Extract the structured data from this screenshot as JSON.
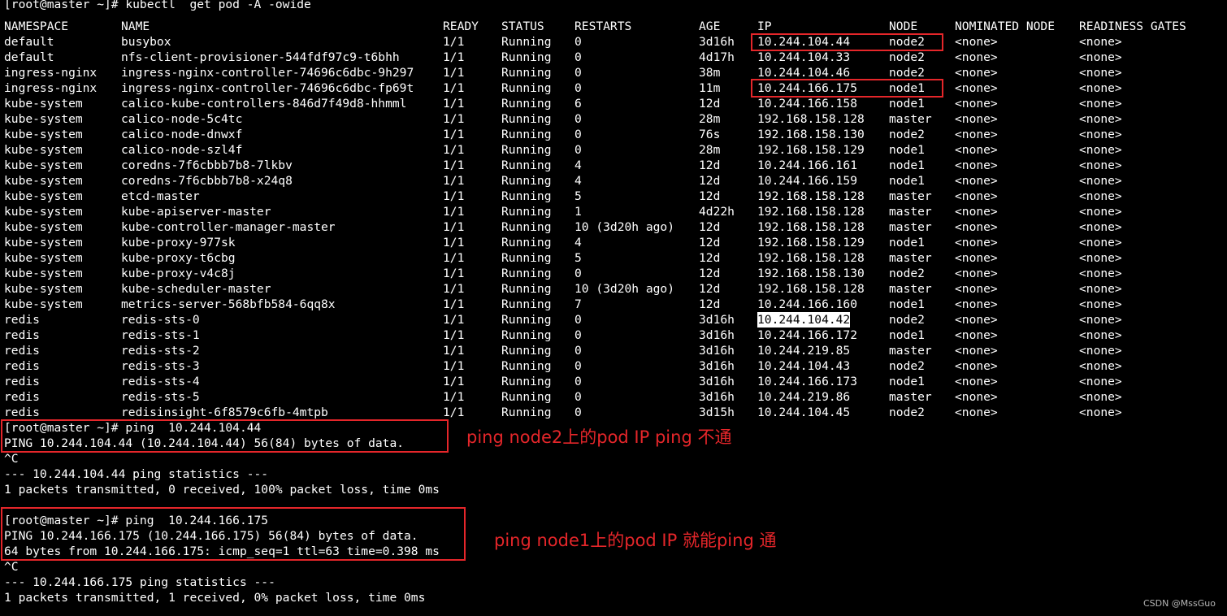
{
  "terminal": {
    "cutoff_line": "[root@master ~]# kubectl  get pod -A -owide",
    "table": {
      "headers": [
        "NAMESPACE",
        "NAME",
        "READY",
        "STATUS",
        "RESTARTS",
        "AGE",
        "IP",
        "NODE",
        "NOMINATED NODE",
        "READINESS GATES"
      ],
      "rows": [
        [
          "default",
          "busybox",
          "1/1",
          "Running",
          "0",
          "3d16h",
          "10.244.104.44",
          "node2",
          "<none>",
          "<none>"
        ],
        [
          "default",
          "nfs-client-provisioner-544fdf97c9-t6bhh",
          "1/1",
          "Running",
          "0",
          "4d17h",
          "10.244.104.33",
          "node2",
          "<none>",
          "<none>"
        ],
        [
          "ingress-nginx",
          "ingress-nginx-controller-74696c6dbc-9h297",
          "1/1",
          "Running",
          "0",
          "38m",
          "10.244.104.46",
          "node2",
          "<none>",
          "<none>"
        ],
        [
          "ingress-nginx",
          "ingress-nginx-controller-74696c6dbc-fp69t",
          "1/1",
          "Running",
          "0",
          "11m",
          "10.244.166.175",
          "node1",
          "<none>",
          "<none>"
        ],
        [
          "kube-system",
          "calico-kube-controllers-846d7f49d8-hhmml",
          "1/1",
          "Running",
          "6",
          "12d",
          "10.244.166.158",
          "node1",
          "<none>",
          "<none>"
        ],
        [
          "kube-system",
          "calico-node-5c4tc",
          "1/1",
          "Running",
          "0",
          "28m",
          "192.168.158.128",
          "master",
          "<none>",
          "<none>"
        ],
        [
          "kube-system",
          "calico-node-dnwxf",
          "1/1",
          "Running",
          "0",
          "76s",
          "192.168.158.130",
          "node2",
          "<none>",
          "<none>"
        ],
        [
          "kube-system",
          "calico-node-szl4f",
          "1/1",
          "Running",
          "0",
          "28m",
          "192.168.158.129",
          "node1",
          "<none>",
          "<none>"
        ],
        [
          "kube-system",
          "coredns-7f6cbbb7b8-7lkbv",
          "1/1",
          "Running",
          "4",
          "12d",
          "10.244.166.161",
          "node1",
          "<none>",
          "<none>"
        ],
        [
          "kube-system",
          "coredns-7f6cbbb7b8-x24q8",
          "1/1",
          "Running",
          "4",
          "12d",
          "10.244.166.159",
          "node1",
          "<none>",
          "<none>"
        ],
        [
          "kube-system",
          "etcd-master",
          "1/1",
          "Running",
          "5",
          "12d",
          "192.168.158.128",
          "master",
          "<none>",
          "<none>"
        ],
        [
          "kube-system",
          "kube-apiserver-master",
          "1/1",
          "Running",
          "1",
          "4d22h",
          "192.168.158.128",
          "master",
          "<none>",
          "<none>"
        ],
        [
          "kube-system",
          "kube-controller-manager-master",
          "1/1",
          "Running",
          "10 (3d20h ago)",
          "12d",
          "192.168.158.128",
          "master",
          "<none>",
          "<none>"
        ],
        [
          "kube-system",
          "kube-proxy-977sk",
          "1/1",
          "Running",
          "4",
          "12d",
          "192.168.158.129",
          "node1",
          "<none>",
          "<none>"
        ],
        [
          "kube-system",
          "kube-proxy-t6cbg",
          "1/1",
          "Running",
          "5",
          "12d",
          "192.168.158.128",
          "master",
          "<none>",
          "<none>"
        ],
        [
          "kube-system",
          "kube-proxy-v4c8j",
          "1/1",
          "Running",
          "0",
          "12d",
          "192.168.158.130",
          "node2",
          "<none>",
          "<none>"
        ],
        [
          "kube-system",
          "kube-scheduler-master",
          "1/1",
          "Running",
          "10 (3d20h ago)",
          "12d",
          "192.168.158.128",
          "master",
          "<none>",
          "<none>"
        ],
        [
          "kube-system",
          "metrics-server-568bfb584-6qq8x",
          "1/1",
          "Running",
          "7",
          "12d",
          "10.244.166.160",
          "node1",
          "<none>",
          "<none>"
        ],
        [
          "redis",
          "redis-sts-0",
          "1/1",
          "Running",
          "0",
          "3d16h",
          "10.244.104.42",
          "node2",
          "<none>",
          "<none>"
        ],
        [
          "redis",
          "redis-sts-1",
          "1/1",
          "Running",
          "0",
          "3d16h",
          "10.244.166.172",
          "node1",
          "<none>",
          "<none>"
        ],
        [
          "redis",
          "redis-sts-2",
          "1/1",
          "Running",
          "0",
          "3d16h",
          "10.244.219.85",
          "master",
          "<none>",
          "<none>"
        ],
        [
          "redis",
          "redis-sts-3",
          "1/1",
          "Running",
          "0",
          "3d16h",
          "10.244.104.43",
          "node2",
          "<none>",
          "<none>"
        ],
        [
          "redis",
          "redis-sts-4",
          "1/1",
          "Running",
          "0",
          "3d16h",
          "10.244.166.173",
          "node1",
          "<none>",
          "<none>"
        ],
        [
          "redis",
          "redis-sts-5",
          "1/1",
          "Running",
          "0",
          "3d16h",
          "10.244.219.86",
          "master",
          "<none>",
          "<none>"
        ],
        [
          "redis",
          "redisinsight-6f8579c6fb-4mtpb",
          "1/1",
          "Running",
          "0",
          "3d15h",
          "10.244.104.45",
          "node2",
          "<none>",
          "<none>"
        ]
      ]
    },
    "ping1": {
      "prompt": "[root@master ~]# ping  10.244.104.44",
      "header": "PING 10.244.104.44 (10.244.104.44) 56(84) bytes of data.",
      "interrupt": "^C",
      "stats_title": "--- 10.244.104.44 ping statistics ---",
      "stats": "1 packets transmitted, 0 received, 100% packet loss, time 0ms"
    },
    "ping2": {
      "prompt": "[root@master ~]# ping  10.244.166.175",
      "header": "PING 10.244.166.175 (10.244.166.175) 56(84) bytes of data.",
      "reply": "64 bytes from 10.244.166.175: icmp_seq=1 ttl=63 time=0.398 ms",
      "interrupt": "^C",
      "stats_title": "--- 10.244.166.175 ping statistics ---",
      "stats": "1 packets transmitted, 1 received, 0% packet loss, time 0ms"
    }
  },
  "annotations": {
    "ping_node2": "ping node2上的pod IP ping 不通",
    "ping_node1": "ping node1上的pod IP 就能ping 通"
  },
  "watermark": "CSDN @MssGuo",
  "colors": {
    "background": "#000000",
    "text": "#ffffff",
    "annotation": "#e5262a",
    "selection": "#ffffff"
  }
}
